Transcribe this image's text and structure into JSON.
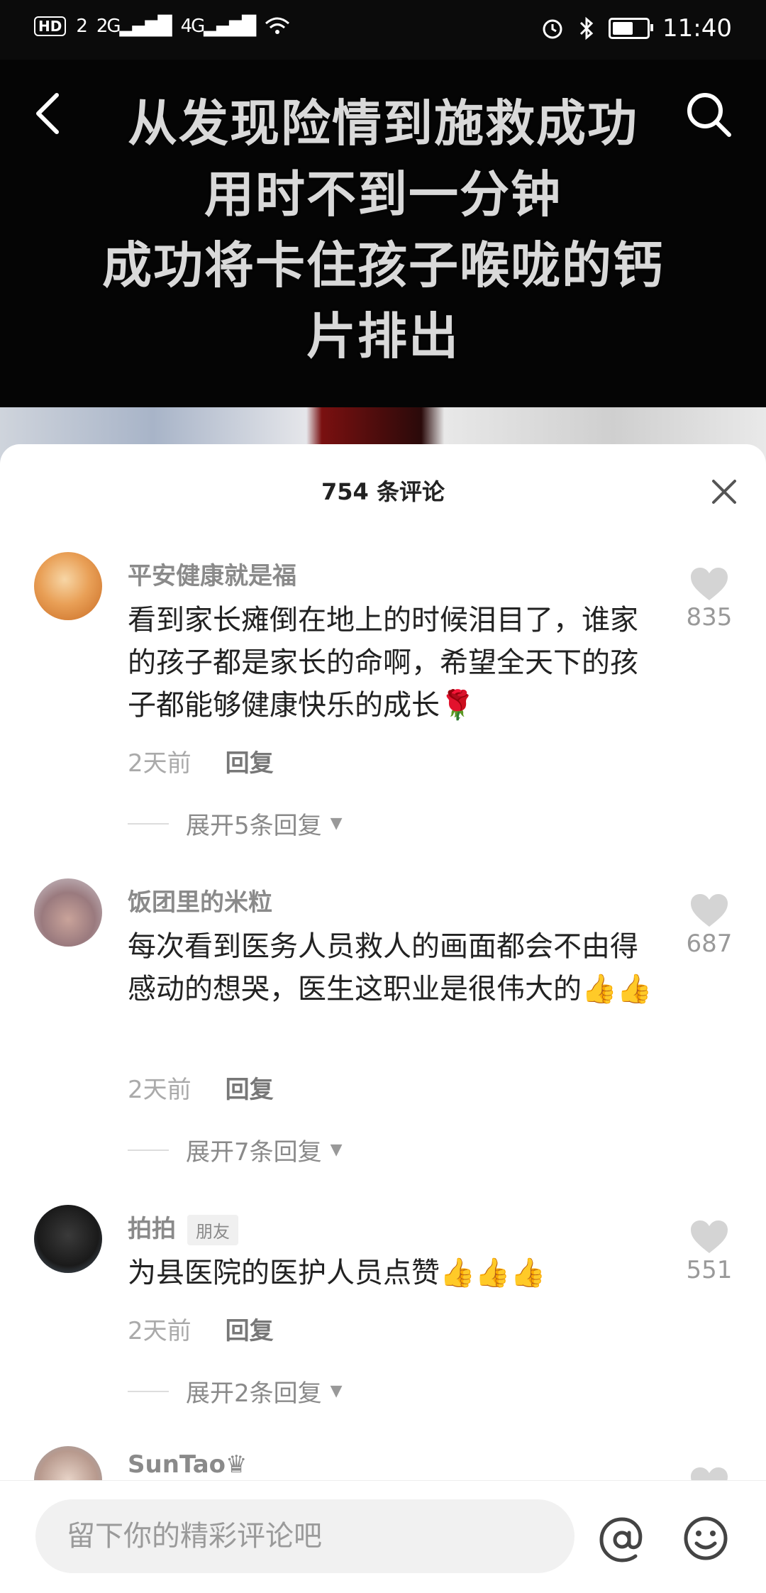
{
  "status_bar": {
    "hd": "HD",
    "sim1": "2",
    "net1": "2G",
    "net2": "4G",
    "time": "11:40"
  },
  "video": {
    "title": "从发现险情到施救成功\n用时不到一分钟\n成功将卡住孩子喉咙的钙\n片排出"
  },
  "comments_panel": {
    "title": "754 条评论",
    "comments": [
      {
        "username": "平安健康就是福",
        "text": "看到家长瘫倒在地上的时候泪目了，谁家的孩子都是家长的命啊，希望全天下的孩子都能够健康快乐的成长🌹",
        "time": "2天前",
        "reply_label": "回复",
        "expand_label": "展开5条回复",
        "likes": "835"
      },
      {
        "username": "饭团里的米粒",
        "text": "每次看到医务人员救人的画面都会不由得感动的想哭，医生这职业是很伟大的👍👍",
        "time": "2天前",
        "reply_label": "回复",
        "expand_label": "展开7条回复",
        "likes": "687"
      },
      {
        "username": "拍拍",
        "tag": "朋友",
        "text": "为县医院的医护人员点赞👍👍👍",
        "time": "2天前",
        "reply_label": "回复",
        "expand_label": "展开2条回复",
        "likes": "551"
      },
      {
        "username": "SunTao♛"
      }
    ]
  },
  "input": {
    "placeholder": "留下你的精彩评论吧"
  }
}
